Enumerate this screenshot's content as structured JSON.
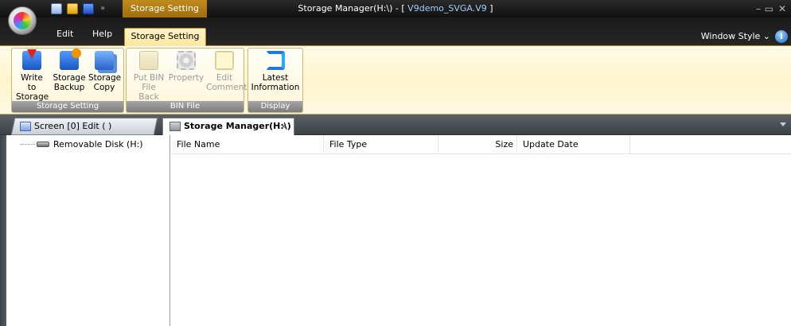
{
  "window": {
    "title_prefix": "Storage Manager(H:\\) - [",
    "title_doc": " V9demo_SVGA.V9 ",
    "title_suffix": "]",
    "controls": {
      "minimize": "–",
      "restore": "▭",
      "close": "✕"
    }
  },
  "context_tab": {
    "label": "Storage Setting"
  },
  "ribbon_tabs": {
    "edit": "Edit",
    "help": "Help",
    "storage_setting": "Storage Setting"
  },
  "window_style": {
    "label": "Window Style",
    "chevron": "⌄"
  },
  "help_icon": {
    "glyph": "i"
  },
  "qat": {
    "more": "»"
  },
  "groups": {
    "storage_setting": {
      "label": "Storage Setting",
      "buttons": [
        {
          "line1": "Write to",
          "line2": "Storage"
        },
        {
          "line1": "Storage",
          "line2": "Backup"
        },
        {
          "line1": "Storage",
          "line2": "Copy"
        }
      ]
    },
    "bin_file": {
      "label": "BIN File",
      "buttons": [
        {
          "line1": "Put BIN",
          "line2": "File Back"
        },
        {
          "line1": "Property",
          "line2": ""
        },
        {
          "line1": "Edit",
          "line2": "Comment"
        }
      ]
    },
    "display": {
      "label": "Display",
      "buttons": [
        {
          "line1": "Latest",
          "line2": "Information"
        }
      ]
    }
  },
  "doc_tabs": {
    "inactive": "Screen [0] Edit (           )",
    "active": "Storage Manager(H:\\)",
    "close": "×"
  },
  "tree": {
    "root": "Removable Disk (H:)"
  },
  "list": {
    "columns": {
      "name": "File Name",
      "type": "File Type",
      "size": "Size",
      "date": "Update Date"
    }
  },
  "colors": {
    "context_accent": "#c08b1c",
    "ribbon_bg": "#fff4cd",
    "title_doc": "#9fd0ff"
  }
}
